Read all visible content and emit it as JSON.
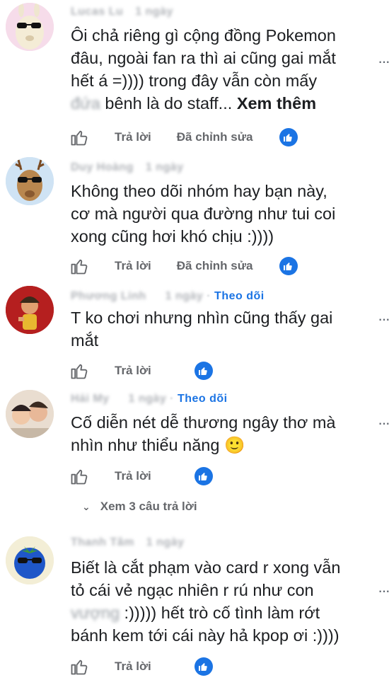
{
  "comments": [
    {
      "meta": {
        "name": "Lucas Lu",
        "time": "1 ngày",
        "follow": ""
      },
      "lines": [
        "Ôi chả riêng gì cộng đồng Pokemon",
        "đâu, ngoài fan ra thì ai cũng gai mắt",
        "hết á =)))) trong đây vẫn còn mấy"
      ],
      "last_line_faded": "đứa",
      "last_line_rest": " bênh là do staff... ",
      "see_more": "Xem thêm",
      "reply_label": "Trả lời",
      "edited_label": "Đã chỉnh sửa"
    },
    {
      "meta": {
        "name": "Duy Hoàng",
        "time": "1 ngày",
        "follow": ""
      },
      "lines": [
        "Không theo dõi nhóm hay bạn này,",
        "cơ mà người qua đường như tui coi",
        "xong cũng hơi khó chịu :))))"
      ],
      "reply_label": "Trả lời",
      "edited_label": "Đã chỉnh sửa"
    },
    {
      "meta": {
        "name": "Phương Linh",
        "time": "1 ngày",
        "follow": "Theo dõi"
      },
      "lines": [
        "T ko chơi nhưng nhìn cũng thấy gai",
        "mắt"
      ],
      "reply_label": "Trả lời"
    },
    {
      "meta": {
        "name": "Hải My",
        "time": "1 ngày",
        "follow": "Theo dõi"
      },
      "lines": [
        "Cố diễn nét dễ thương ngây thơ mà",
        "nhìn như thiểu năng"
      ],
      "emoji": "🙂",
      "reply_label": "Trả lời",
      "view_replies": "Xem 3 câu trả lời"
    },
    {
      "meta": {
        "name": "Thanh Tâm",
        "time": "1 ngày",
        "follow": ""
      },
      "lines": [
        "Biết là cắt phạm vào card r xong vẫn",
        "tỏ cái vẻ ngạc nhiên r rú như con"
      ],
      "line3_faded": "vượng",
      "line3_rest": " :))))) hết trò cố tình làm rớt",
      "line4": "bánh kem tới cái này hả kpop ơi :))))",
      "reply_label": "Trả lời"
    }
  ],
  "more_menu": "···",
  "colors": {
    "accent": "#1b74e4",
    "muted": "#65676b",
    "text": "#1c1e21"
  }
}
